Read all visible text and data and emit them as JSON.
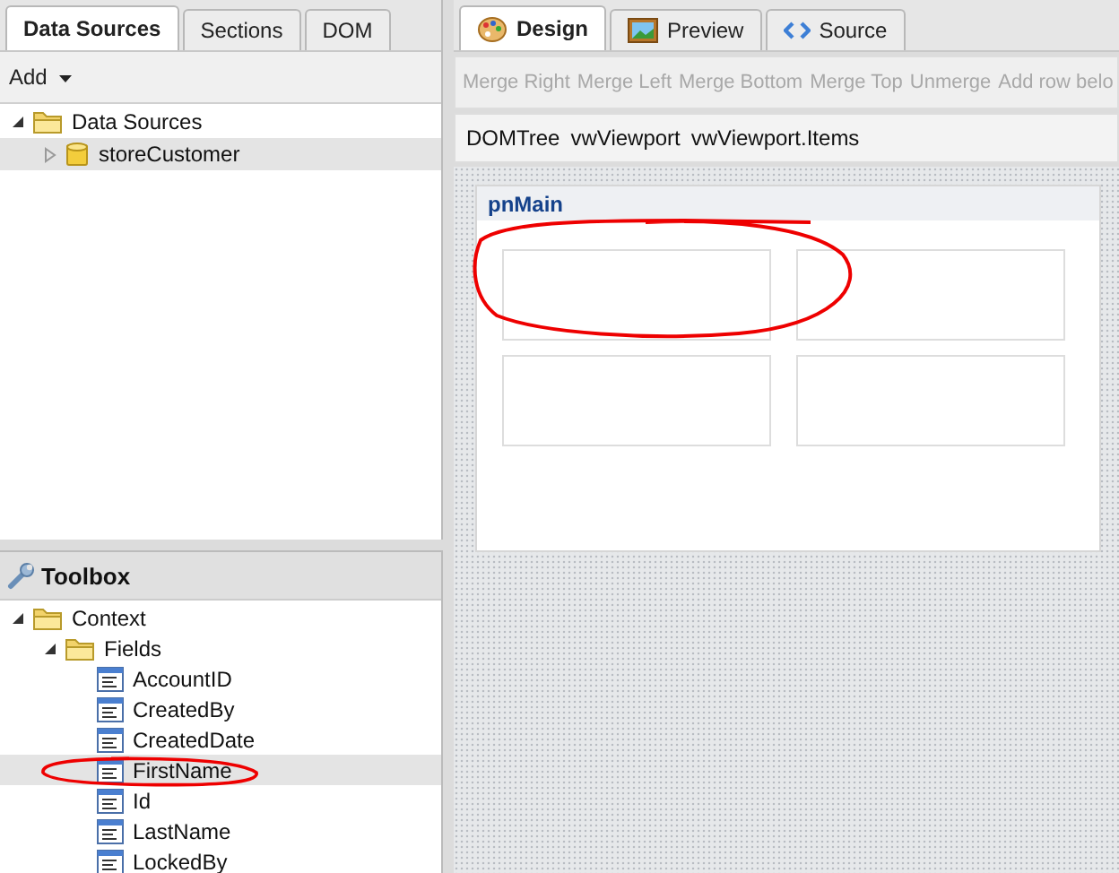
{
  "left_tabs": [
    {
      "label": "Data Sources",
      "selected": true
    },
    {
      "label": "Sections",
      "selected": false
    },
    {
      "label": "DOM",
      "selected": false
    }
  ],
  "data_toolbar": {
    "add_label": "Add"
  },
  "data_tree": [
    {
      "label": "Data Sources",
      "kind": "folder",
      "expanded": true,
      "selected": false,
      "children": [
        {
          "label": "storeCustomer",
          "kind": "store",
          "expanded": false,
          "selected": true
        }
      ]
    }
  ],
  "toolbox": {
    "title": "Toolbox",
    "tree": [
      {
        "label": "Context",
        "kind": "folder",
        "expanded": true,
        "selected": false,
        "children": [
          {
            "label": "Fields",
            "kind": "folder",
            "expanded": true,
            "selected": false,
            "children": [
              {
                "label": "AccountID",
                "kind": "field",
                "selected": false
              },
              {
                "label": "CreatedBy",
                "kind": "field",
                "selected": false
              },
              {
                "label": "CreatedDate",
                "kind": "field",
                "selected": false
              },
              {
                "label": "FirstName",
                "kind": "field",
                "selected": true
              },
              {
                "label": "Id",
                "kind": "field",
                "selected": false
              },
              {
                "label": "LastName",
                "kind": "field",
                "selected": false
              },
              {
                "label": "LockedBy",
                "kind": "field",
                "selected": false
              }
            ]
          }
        ]
      }
    ]
  },
  "right_tabs": [
    {
      "label": "Design",
      "kind": "design",
      "selected": true
    },
    {
      "label": "Preview",
      "kind": "preview",
      "selected": false
    },
    {
      "label": "Source",
      "kind": "source",
      "selected": false
    }
  ],
  "design_toolbar": [
    {
      "label": "Merge Right",
      "disabled": true
    },
    {
      "label": "Merge Left",
      "disabled": true
    },
    {
      "label": "Merge Bottom",
      "disabled": true
    },
    {
      "label": "Merge Top",
      "disabled": true
    },
    {
      "label": "Unmerge",
      "disabled": true
    },
    {
      "label": "Add row belo",
      "disabled": true
    }
  ],
  "breadcrumb": [
    "DOMTree",
    "vwViewport",
    "vwViewport.Items"
  ],
  "designer": {
    "panel_title": "pnMain"
  }
}
